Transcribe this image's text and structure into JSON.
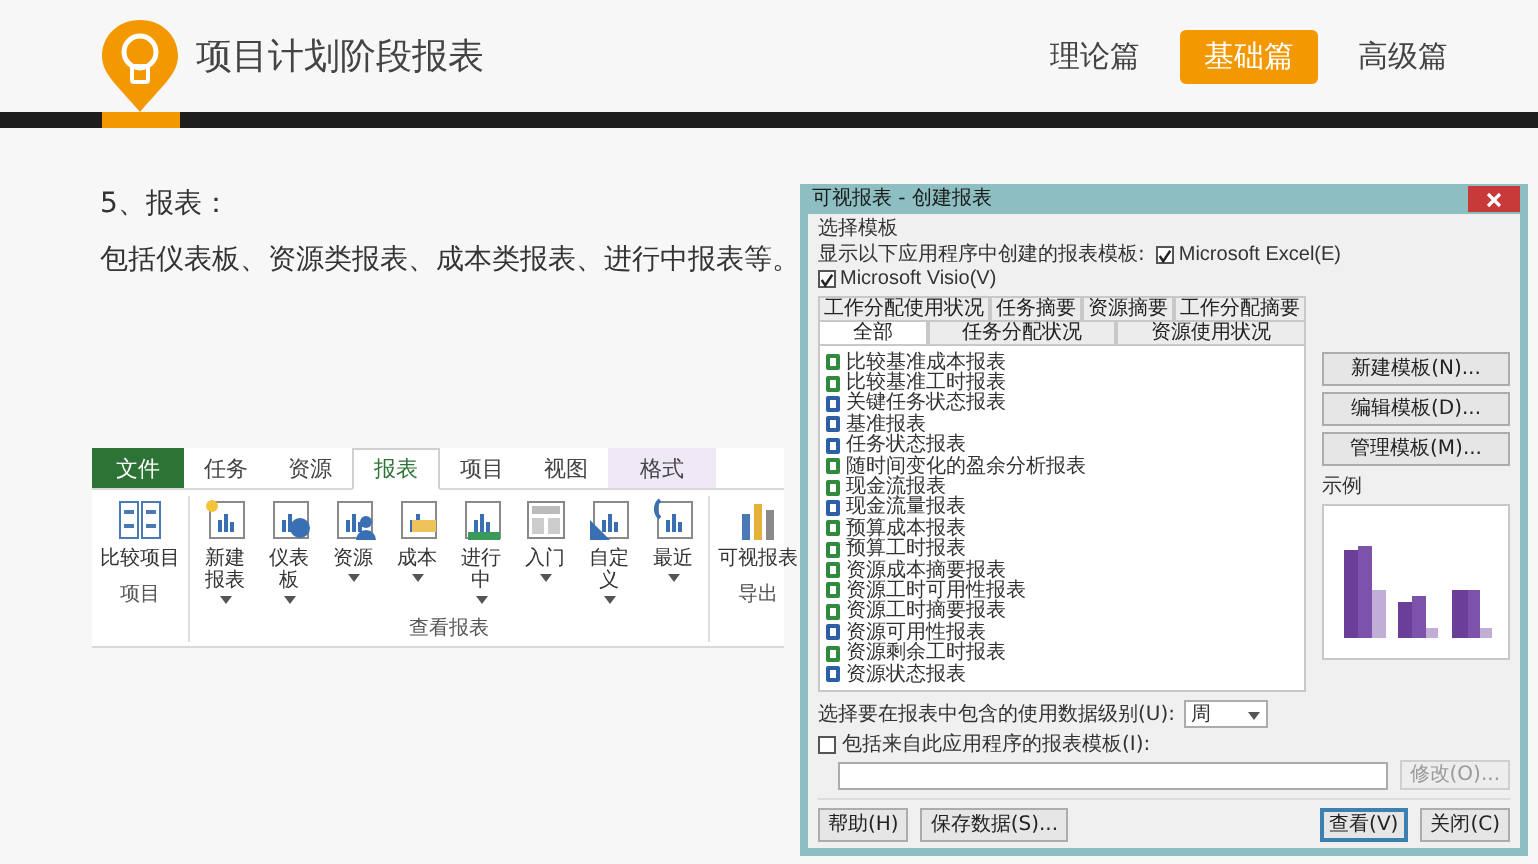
{
  "header": {
    "title": "项目计划阶段报表",
    "nav": [
      {
        "label": "理论篇",
        "selected": false
      },
      {
        "label": "基础篇",
        "selected": true
      },
      {
        "label": "高级篇",
        "selected": false
      }
    ]
  },
  "content": {
    "heading": "5、报表：",
    "body": "包括仪表板、资源类报表、成本类报表、进行中报表等。"
  },
  "ribbon": {
    "tabs": [
      {
        "label": "文件",
        "kind": "file",
        "selected": false
      },
      {
        "label": "任务",
        "kind": "normal",
        "selected": false
      },
      {
        "label": "资源",
        "kind": "normal",
        "selected": false
      },
      {
        "label": "报表",
        "kind": "normal",
        "selected": true
      },
      {
        "label": "项目",
        "kind": "normal",
        "selected": false
      },
      {
        "label": "视图",
        "kind": "normal",
        "selected": false
      },
      {
        "label": "格式",
        "kind": "contextual",
        "selected": false
      }
    ],
    "groups": [
      {
        "label": "项目",
        "buttons": [
          {
            "label": "比较项目",
            "dropdown": false
          }
        ]
      },
      {
        "label": "查看报表",
        "buttons": [
          {
            "label": "新建报表",
            "dropdown": true
          },
          {
            "label": "仪表板",
            "dropdown": true
          },
          {
            "label": "资源",
            "dropdown": true
          },
          {
            "label": "成本",
            "dropdown": true
          },
          {
            "label": "进行中",
            "dropdown": true
          },
          {
            "label": "入门",
            "dropdown": true
          },
          {
            "label": "自定义",
            "dropdown": true
          },
          {
            "label": "最近",
            "dropdown": true
          }
        ]
      },
      {
        "label": "导出",
        "buttons": [
          {
            "label": "可视报表",
            "dropdown": false
          }
        ]
      }
    ]
  },
  "dialog": {
    "title": "可视报表 - 创建报表",
    "section": "选择模板",
    "apps_prompt": "显示以下应用程序中创建的报表模板:",
    "apps": [
      {
        "label": "Microsoft Excel(E)",
        "checked": true
      },
      {
        "label": "Microsoft Visio(V)",
        "checked": true
      }
    ],
    "tab_rows": [
      [
        {
          "label": "工作分配使用状况",
          "selected": false
        },
        {
          "label": "任务摘要",
          "selected": false
        },
        {
          "label": "资源摘要",
          "selected": false
        },
        {
          "label": "工作分配摘要",
          "selected": false
        }
      ],
      [
        {
          "label": "全部",
          "selected": true
        },
        {
          "label": "任务分配状况",
          "selected": false
        },
        {
          "label": "资源使用状况",
          "selected": false
        }
      ]
    ],
    "templates": [
      {
        "label": "比较基准成本报表",
        "kind": "excel"
      },
      {
        "label": "比较基准工时报表",
        "kind": "excel"
      },
      {
        "label": "关键任务状态报表",
        "kind": "visio"
      },
      {
        "label": "基准报表",
        "kind": "visio"
      },
      {
        "label": "任务状态报表",
        "kind": "visio"
      },
      {
        "label": "随时间变化的盈余分析报表",
        "kind": "excel"
      },
      {
        "label": "现金流报表",
        "kind": "excel"
      },
      {
        "label": "现金流量报表",
        "kind": "visio"
      },
      {
        "label": "预算成本报表",
        "kind": "excel"
      },
      {
        "label": "预算工时报表",
        "kind": "excel"
      },
      {
        "label": "资源成本摘要报表",
        "kind": "excel"
      },
      {
        "label": "资源工时可用性报表",
        "kind": "excel"
      },
      {
        "label": "资源工时摘要报表",
        "kind": "excel"
      },
      {
        "label": "资源可用性报表",
        "kind": "visio"
      },
      {
        "label": "资源剩余工时报表",
        "kind": "excel"
      },
      {
        "label": "资源状态报表",
        "kind": "visio"
      }
    ],
    "template_buttons": [
      "新建模板(N)...",
      "编辑模板(D)...",
      "管理模板(M)..."
    ],
    "preview_label": "示例",
    "usage_label": "选择要在报表中包含的使用数据级别(U):",
    "usage_value": "周",
    "include": {
      "label": "包括来自此应用程序的报表模板(I):",
      "checked": false
    },
    "modify_button": {
      "label": "修改(O)...",
      "disabled": true
    },
    "left_buttons": [
      {
        "label": "帮助(H)",
        "default": false
      },
      {
        "label": "保存数据(S)...",
        "default": false
      }
    ],
    "right_buttons": [
      {
        "label": "查看(V)",
        "default": true
      },
      {
        "label": "关闭(C)",
        "default": false
      }
    ]
  }
}
